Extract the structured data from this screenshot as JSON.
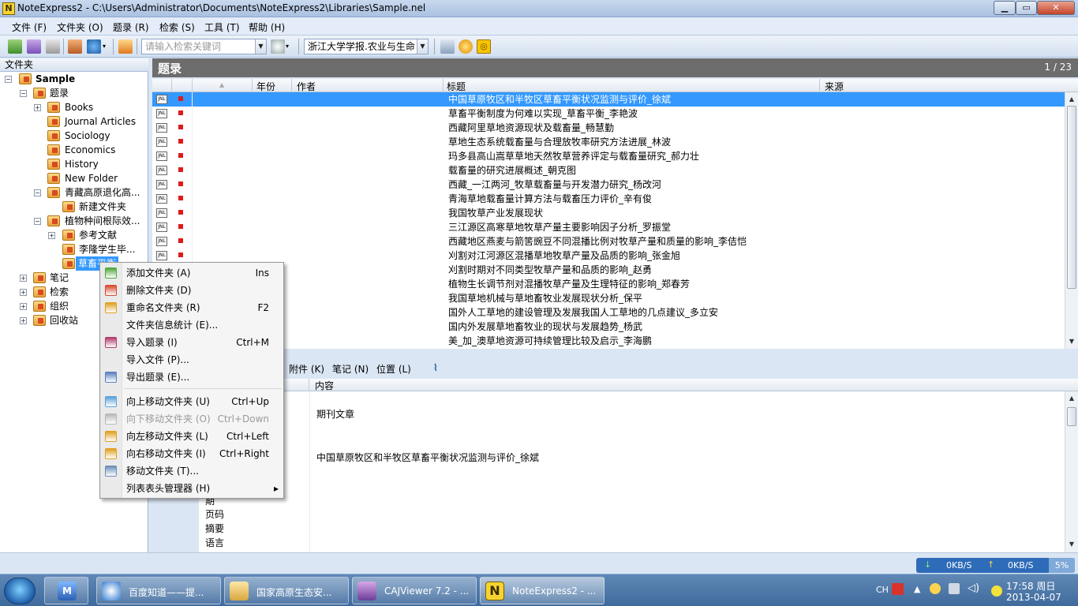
{
  "window": {
    "app_icon": "N",
    "title": "NoteExpress2 - C:\\Users\\Administrator\\Documents\\NoteExpress2\\Libraries\\Sample.nel"
  },
  "menubar": [
    "文件 (F)",
    "文件夹 (O)",
    "题录 (R)",
    "检索 (S)",
    "工具 (T)",
    "帮助 (H)"
  ],
  "toolbar": {
    "search_placeholder": "请输入检索关键词",
    "journal_value": "浙江大学学报.农业与生命"
  },
  "sidebar": {
    "header": "文件夹",
    "root": "Sample",
    "records_folder": "题录",
    "folders": [
      "Books",
      "Journal Articles",
      "Sociology",
      "Economics",
      "History",
      "New Folder"
    ],
    "qinghai_folder": "青藏高原退化高...",
    "qinghai_sub": "新建文件夹",
    "plant_folder": "植物种间根际效...",
    "plant_sub1": "参考文献",
    "plant_sub2": "李隆学生毕...",
    "selected_folder": "草畜平衡",
    "notes": "笔记",
    "search": "检索",
    "organize": "组织",
    "recycle": "回收站"
  },
  "records": {
    "title": "题录",
    "count": "1 / 23",
    "columns": {
      "year": "年份",
      "author": "作者",
      "title": "标题",
      "source": "来源"
    },
    "icon_label": "JNL",
    "rows": [
      "中国草原牧区和半牧区草畜平衡状况监测与评价_徐斌",
      "草畜平衡制度为何难以实现_草畜平衡_李艳波",
      "西藏阿里草地资源现状及载畜量_畅慧勤",
      "草地生态系统载畜量与合理放牧率研究方法进展_林波",
      "玛多县高山嵩草草地天然牧草营养评定与载畜量研究_郝力壮",
      "载畜量的研究进展概述_朝克图",
      "西藏_一江两河_牧草载畜量与开发潜力研究_杨改河",
      "青海草地载畜量计算方法与载畜压力评价_辛有俊",
      "我国牧草产业发展现状",
      "三江源区高寒草地牧草产量主要影响因子分析_罗振堂",
      "西藏地区燕麦与箭筈豌豆不同混播比例对牧草产量和质量的影响_李佶恺",
      "刈割对江河源区混播草地牧草产量及品质的影响_张金旭",
      "刈割时期对不同类型牧草产量和品质的影响_赵勇",
      "植物生长调节剂对混播牧草产量及生理特征的影响_郑春芳",
      "我国草地机械与草地畜牧业发展现状分析_保平",
      "国外人工草地的建设管理及发展我国人工草地的几点建议_多立安",
      "国内外发展草地畜牧业的现状与发展趋势_杨武",
      "美_加_澳草地资源可持续管理比较及启示_李海鹏"
    ]
  },
  "detail": {
    "tabs": [
      "附件 (K)",
      "笔记 (N)",
      "位置 (L)"
    ],
    "content_header": "内容",
    "type_value": "期刊文章",
    "title_value": "中国草原牧区和半牧区草畜平衡状况监测与评价_徐斌",
    "fields": [
      "期",
      "页码",
      "摘要",
      "语言"
    ]
  },
  "context_menu": {
    "items": [
      {
        "label": "添加文件夹 (A)",
        "shortcut": "Ins",
        "disabled": false
      },
      {
        "label": "删除文件夹 (D)",
        "shortcut": "",
        "disabled": false
      },
      {
        "label": "重命名文件夹 (R)",
        "shortcut": "F2",
        "disabled": false
      },
      {
        "label": "文件夹信息统计 (E)...",
        "shortcut": "",
        "disabled": false
      },
      {
        "label": "导入题录 (I)",
        "shortcut": "Ctrl+M",
        "disabled": false
      },
      {
        "label": "导入文件 (P)...",
        "shortcut": "",
        "disabled": false
      },
      {
        "label": "导出题录 (E)...",
        "shortcut": "",
        "disabled": false
      },
      {
        "label": "向上移动文件夹 (U)",
        "shortcut": "Ctrl+Up",
        "disabled": false
      },
      {
        "label": "向下移动文件夹 (O)",
        "shortcut": "Ctrl+Down",
        "disabled": true
      },
      {
        "label": "向左移动文件夹 (L)",
        "shortcut": "Ctrl+Left",
        "disabled": false
      },
      {
        "label": "向右移动文件夹 (I)",
        "shortcut": "Ctrl+Right",
        "disabled": false
      },
      {
        "label": "移动文件夹 (T)...",
        "shortcut": "",
        "disabled": false
      },
      {
        "label": "列表表头管理器 (H)",
        "shortcut": "",
        "disabled": false,
        "submenu_arrow": "▸"
      }
    ]
  },
  "statusbar": {
    "down_speed": "0KB/S",
    "up_speed": "0KB/S",
    "percent": "5%"
  },
  "taskbar": {
    "tasks": [
      "百度知道——提...",
      "国家高原生态安...",
      "CAJViewer 7.2 - ...",
      "NoteExpress2 - ..."
    ],
    "active_index": 3,
    "ime": "CH",
    "time": "17:58 周日",
    "date": "2013-04-07"
  },
  "colors": {
    "selection": "#3399ff",
    "records_header": "#6d6d6d",
    "flag": "#e01a1a",
    "taskbar": "#4a76a8"
  }
}
